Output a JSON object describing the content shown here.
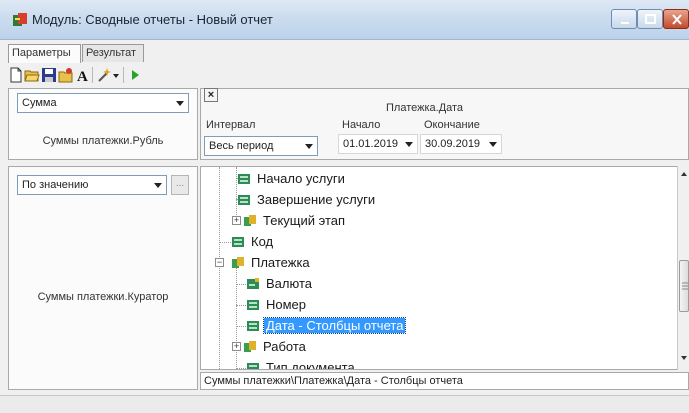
{
  "window": {
    "title": "Модуль: Сводные отчеты - Новый отчет",
    "app_icon": "report-module-icon"
  },
  "tabs": [
    {
      "label": "Параметры",
      "active": true
    },
    {
      "label": "Результат",
      "active": false
    }
  ],
  "toolbar": {
    "icons": [
      "new-document-icon",
      "open-folder-icon",
      "save-icon",
      "save-as-icon",
      "font-icon",
      "settings-wand-icon",
      "dropdown-arrow-icon",
      "run-icon"
    ]
  },
  "left_panel": {
    "measure_combo_value": "Сумма",
    "measure_label": "Суммы платежки.Рубль",
    "sort_combo_value": "По значению",
    "sort_button_label": "...",
    "grouping_label": "Суммы платежки.Куратор"
  },
  "filter": {
    "close_label": "×",
    "field_caption": "Платежка.Дата",
    "interval_label": "Интервал",
    "interval_value": "Весь период",
    "start_label": "Начало",
    "start_value": "01.01.2019",
    "end_label": "Окончание",
    "end_value": "30.09.2019"
  },
  "tree": {
    "nodes": [
      {
        "label": "Начало услуги",
        "icon": "field-icon"
      },
      {
        "label": "Завершение услуги",
        "icon": "field-icon"
      },
      {
        "label": "Текущий этап",
        "icon": "reference-folder-icon"
      },
      {
        "label": "Код",
        "icon": "field-icon"
      },
      {
        "label": "Платежка",
        "icon": "reference-folder-icon"
      },
      {
        "label": "Валюта",
        "icon": "currency-field-icon"
      },
      {
        "label": "Номер",
        "icon": "field-icon"
      },
      {
        "label": "Дата - Столбцы отчета",
        "icon": "date-field-icon",
        "selected": true
      },
      {
        "label": "Работа",
        "icon": "reference-folder-icon"
      },
      {
        "label": "Тип документа",
        "icon": "field-icon"
      }
    ],
    "scroll_position": 0.65
  },
  "path_bar": {
    "text": "Суммы платежки\\Платежка\\Дата - Столбцы отчета"
  }
}
